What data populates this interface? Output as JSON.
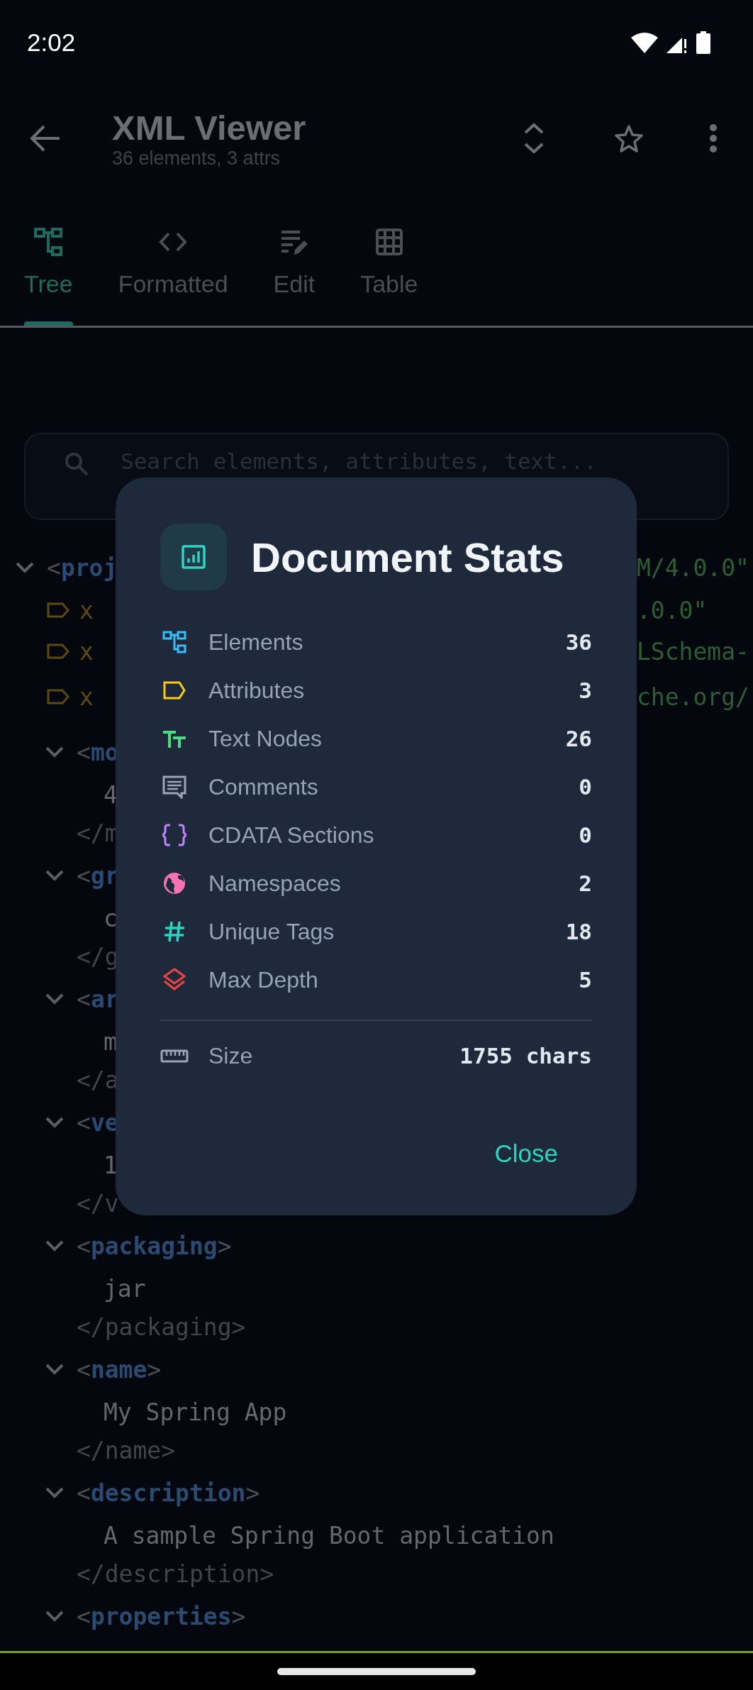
{
  "status_bar": {
    "time": "2:02"
  },
  "app_bar": {
    "title": "XML Viewer",
    "subtitle": "36 elements, 3 attrs"
  },
  "tabs": [
    {
      "label": "Tree",
      "selected": true
    },
    {
      "label": "Formatted",
      "selected": false
    },
    {
      "label": "Edit",
      "selected": false
    },
    {
      "label": "Table",
      "selected": false
    }
  ],
  "search": {
    "placeholder": "Search elements, attributes, text..."
  },
  "tree": {
    "open": "<**proj**",
    "open_tail": "M/4.0.0\"",
    "expanded": true,
    "attributes": [
      {
        "name": "x",
        "value_tail": ".0.0\""
      },
      {
        "name": "x",
        "value_tail": "LSchema-"
      },
      {
        "name": "x",
        "value_tail": "che.org/"
      }
    ],
    "children": [
      {
        "open": "<**mo**",
        "expanded": true,
        "text": "4",
        "close": "</m"
      },
      {
        "open": "<**gr**",
        "expanded": true,
        "text": "c",
        "close": "</g"
      },
      {
        "open": "<**ar**",
        "expanded": true,
        "text": "m",
        "close": "</a"
      },
      {
        "open": "<**ve**",
        "expanded": true,
        "text": "1",
        "close": "</v"
      },
      {
        "open": "<**packaging**>",
        "expanded": true,
        "text": "jar",
        "close": "</packaging>"
      },
      {
        "open": "<**name**>",
        "expanded": true,
        "text": "My Spring App",
        "close": "</name>"
      },
      {
        "open": "<**description**>",
        "expanded": true,
        "text": "A sample Spring Boot application",
        "close": "</description>"
      },
      {
        "open": "<**properties**>",
        "expanded": true
      }
    ]
  },
  "dialog": {
    "title": "Document Stats",
    "stats": [
      {
        "label": "Elements",
        "value": "36"
      },
      {
        "label": "Attributes",
        "value": "3"
      },
      {
        "label": "Text Nodes",
        "value": "26"
      },
      {
        "label": "Comments",
        "value": "0"
      },
      {
        "label": "CDATA Sections",
        "value": "0"
      },
      {
        "label": "Namespaces",
        "value": "2"
      },
      {
        "label": "Unique Tags",
        "value": "18"
      },
      {
        "label": "Max Depth",
        "value": "5"
      }
    ],
    "size": {
      "label": "Size",
      "value": "1755 chars"
    },
    "close_button": "Close"
  }
}
